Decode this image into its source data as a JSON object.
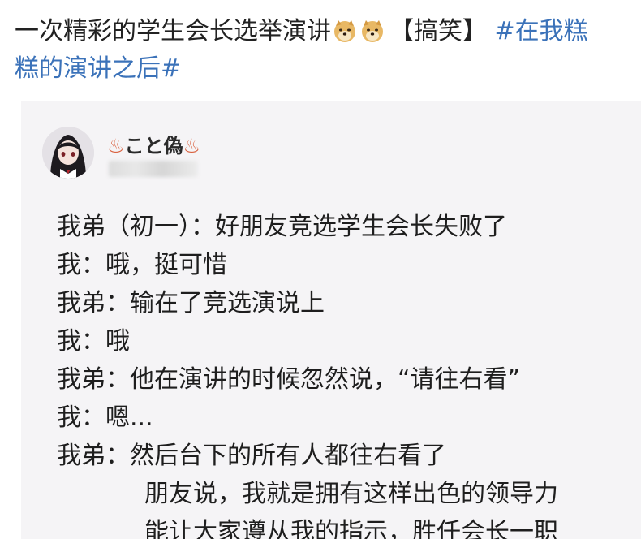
{
  "post": {
    "title_text": "一次精彩的学生会长选举演讲",
    "emoji_1": "doge",
    "emoji_2": "doge",
    "tag_bracket": "【搞笑】",
    "hashtag_line1": "#在我糕",
    "hashtag_line2": "糕的演讲之后#"
  },
  "screenshot": {
    "username_left_decor": "♨",
    "username": "こと偽",
    "username_right_decor": "♨",
    "dialog": [
      {
        "speaker": "我弟（初一）：",
        "text": "好朋友竞选学生会长失败了"
      },
      {
        "speaker": "我：",
        "text": "哦，挺可惜"
      },
      {
        "speaker": "我弟：",
        "text": "输在了竞选演说上"
      },
      {
        "speaker": "我：",
        "text": "哦"
      },
      {
        "speaker": "我弟：",
        "text": "他在演讲的时候忽然说，“请往右看”"
      },
      {
        "speaker": "我：",
        "text": "嗯..."
      },
      {
        "speaker": "我弟：",
        "text": "然后台下的所有人都往右看了"
      },
      {
        "speaker": "",
        "text": "朋友说，我就是拥有这样出色的领导力"
      },
      {
        "speaker": "",
        "text": "能让大家遵从我的指示，胜任会长一职"
      }
    ]
  }
}
